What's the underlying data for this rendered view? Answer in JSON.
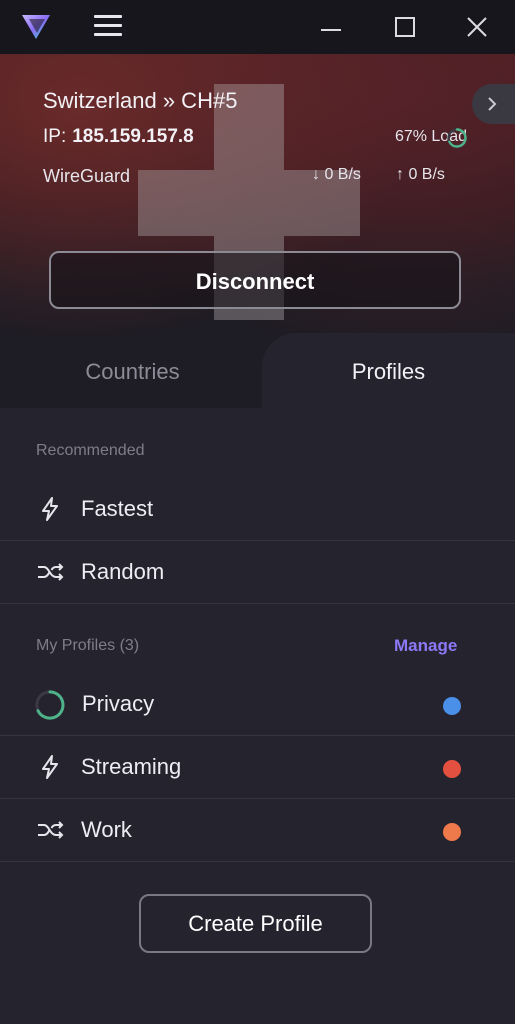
{
  "header": {
    "logo_icon": "proton-vpn-logo-icon",
    "menu_icon": "hamburger-menu-icon",
    "window_controls": [
      "minimize-icon",
      "maximize-icon",
      "close-icon"
    ]
  },
  "connection": {
    "title": "Switzerland » CH#5",
    "ip_label": "IP:",
    "ip_value": "185.159.157.8",
    "load": "67% Load",
    "protocol": "WireGuard",
    "download": "0 B/s",
    "upload": "0 B/s",
    "disconnect_label": "Disconnect",
    "load_fraction": 0.67,
    "load_color": "#4fb38a"
  },
  "tabs": {
    "countries": "Countries",
    "profiles": "Profiles",
    "active": "profiles"
  },
  "recommended": {
    "heading": "Recommended",
    "items": [
      {
        "label": "Fastest",
        "icon": "lightning-icon"
      },
      {
        "label": "Random",
        "icon": "shuffle-icon"
      }
    ]
  },
  "my_profiles": {
    "heading": "My Profiles (3)",
    "manage_label": "Manage",
    "items": [
      {
        "label": "Privacy",
        "icon": "loading-ring-icon",
        "color": "#4a8fe8"
      },
      {
        "label": "Streaming",
        "icon": "lightning-icon",
        "color": "#e4503f"
      },
      {
        "label": "Work",
        "icon": "shuffle-icon",
        "color": "#ee7a4c"
      }
    ]
  },
  "create_profile_label": "Create Profile",
  "colors": {
    "accent": "#8d78f7",
    "background": "#25232e",
    "titlebar": "#17161c"
  }
}
